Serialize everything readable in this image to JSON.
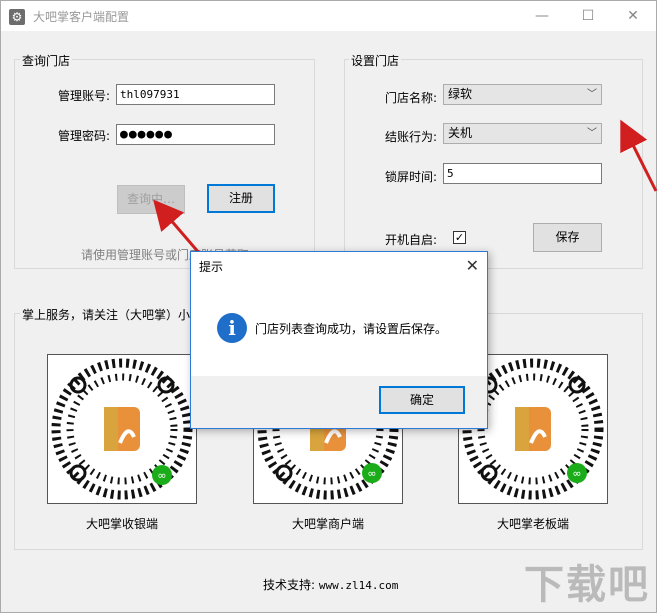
{
  "window": {
    "title": "大吧掌客户端配置",
    "controls": {
      "minimize": "—",
      "maximize": "☐",
      "close": "✕"
    }
  },
  "query_store": {
    "group_title": "查询门店",
    "account_label": "管理账号:",
    "account_value": "thl097931",
    "password_label": "管理密码:",
    "password_value": "●●●●●●",
    "query_button": "查询中…",
    "register_button": "注册",
    "hint": "请使用管理账号或门店账号获取"
  },
  "settings": {
    "group_title": "设置门店",
    "store_name_label": "门店名称:",
    "store_name_value": "绿软",
    "checkout_label": "结账行为:",
    "checkout_value": "关机",
    "lock_label": "锁屏时间:",
    "lock_value": "5",
    "autostart_label": "开机自启:",
    "autostart_checked": "✓",
    "save_button": "保存"
  },
  "mobile": {
    "group_title": "掌上服务，请关注（大吧掌）小程序",
    "qr_items": [
      {
        "caption": "大吧掌收银端"
      },
      {
        "caption": "大吧掌商户端"
      },
      {
        "caption": "大吧掌老板端"
      }
    ]
  },
  "support": {
    "label": "技术支持:",
    "url": "www.zl14.com"
  },
  "dialog": {
    "title": "提示",
    "close": "✕",
    "message": "门店列表查询成功，请设置后保存。",
    "ok_button": "确定",
    "icon": "info-icon"
  },
  "watermark": "下载吧",
  "colors": {
    "accent": "#0078d7",
    "arrow": "#d11f1f",
    "info": "#1f6ec9"
  }
}
